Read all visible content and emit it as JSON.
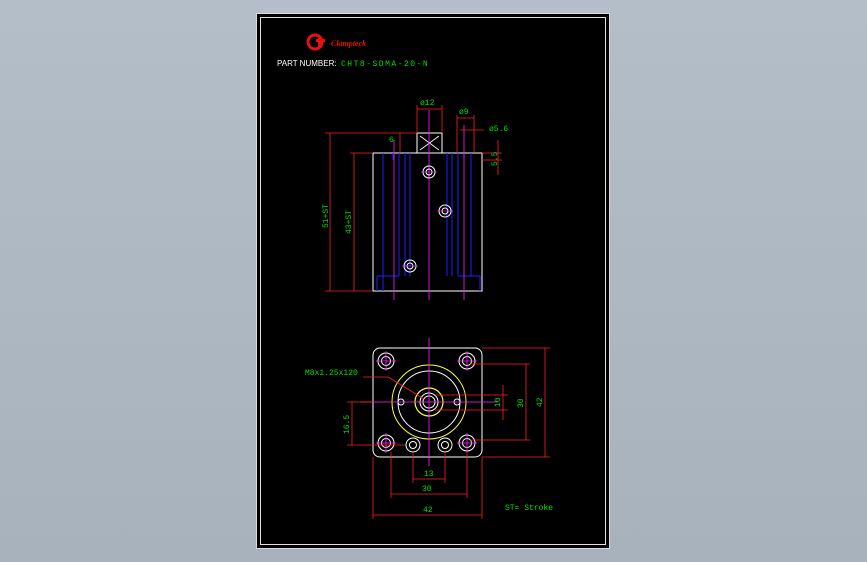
{
  "colors": {
    "background": "#b4bec8",
    "sheet": "#000000",
    "frame": "#e0e0e0",
    "dimension": "#00e000",
    "dimension_line": "#ff2020",
    "outline": "#ffffff",
    "hidden_line": "#2020ff",
    "center_line": "#ff20ff",
    "hole_edge": "#ffff40",
    "logo_red": "#e81010"
  },
  "logo": {
    "text": "Clampteck"
  },
  "part_number": {
    "label": "PART NUMBER:",
    "value": "CHT8-SDMA-20-N"
  },
  "top_view_dims": {
    "d12": "ø12",
    "d9": "ø9",
    "d56": "ø5.6",
    "d6": "6",
    "d55": "5.5",
    "d51st": "51+ST",
    "d43st": "43+ST"
  },
  "bottom_view_dims": {
    "thread": "M8x1.25x120",
    "d10": "10",
    "d30_v": "30",
    "d42_v": "42",
    "d165": "16.5",
    "d13": "13",
    "d30_h": "30",
    "d42_h": "42"
  },
  "note": "ST= Stroke"
}
